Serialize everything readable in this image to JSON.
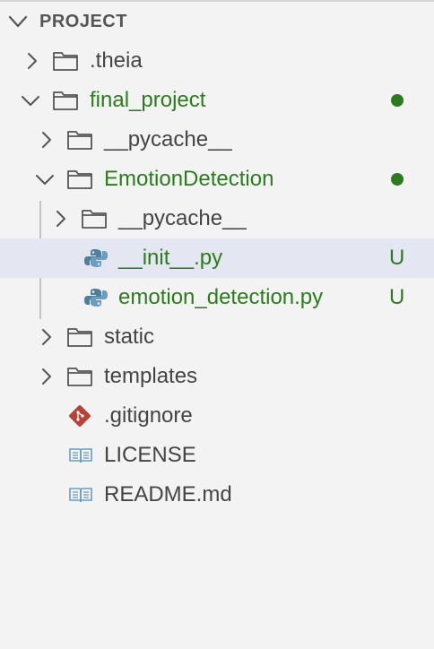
{
  "header": {
    "title": "PROJECT"
  },
  "tree": [
    {
      "key": "theia",
      "label": ".theia",
      "icon": "folder-icon",
      "twisty": "chevron-right-icon"
    },
    {
      "key": "final_project",
      "label": "final_project",
      "icon": "folder-icon",
      "twisty": "chevron-down-icon",
      "status": "modified-dot"
    },
    {
      "key": "pycache_1",
      "label": "__pycache__",
      "icon": "folder-icon",
      "twisty": "chevron-right-icon"
    },
    {
      "key": "emotion_detection_dir",
      "label": "EmotionDetection",
      "icon": "folder-icon",
      "twisty": "chevron-down-icon",
      "status": "modified-dot"
    },
    {
      "key": "pycache_2",
      "label": "__pycache__",
      "icon": "folder-icon",
      "twisty": "chevron-right-icon"
    },
    {
      "key": "init_py",
      "label": "__init__.py",
      "icon": "python-file-icon",
      "badge": "U",
      "selected": true
    },
    {
      "key": "emotion_detection_py",
      "label": "emotion_detection.py",
      "icon": "python-file-icon",
      "badge": "U"
    },
    {
      "key": "static",
      "label": "static",
      "icon": "folder-icon",
      "twisty": "chevron-right-icon"
    },
    {
      "key": "templates",
      "label": "templates",
      "icon": "folder-icon",
      "twisty": "chevron-right-icon"
    },
    {
      "key": "gitignore",
      "label": ".gitignore",
      "icon": "git-file-icon"
    },
    {
      "key": "license",
      "label": "LICENSE",
      "icon": "book-file-icon"
    },
    {
      "key": "readme",
      "label": "README.md",
      "icon": "book-file-icon"
    }
  ],
  "colors": {
    "background": "#f3f3f3",
    "selected_row": "#e4e6f1",
    "git_modified": "#2d7a1f",
    "text": "#444444",
    "python_icon": "#4f7f9a",
    "git_icon": "#b5443a",
    "book_icon": "#6b9cc1"
  }
}
